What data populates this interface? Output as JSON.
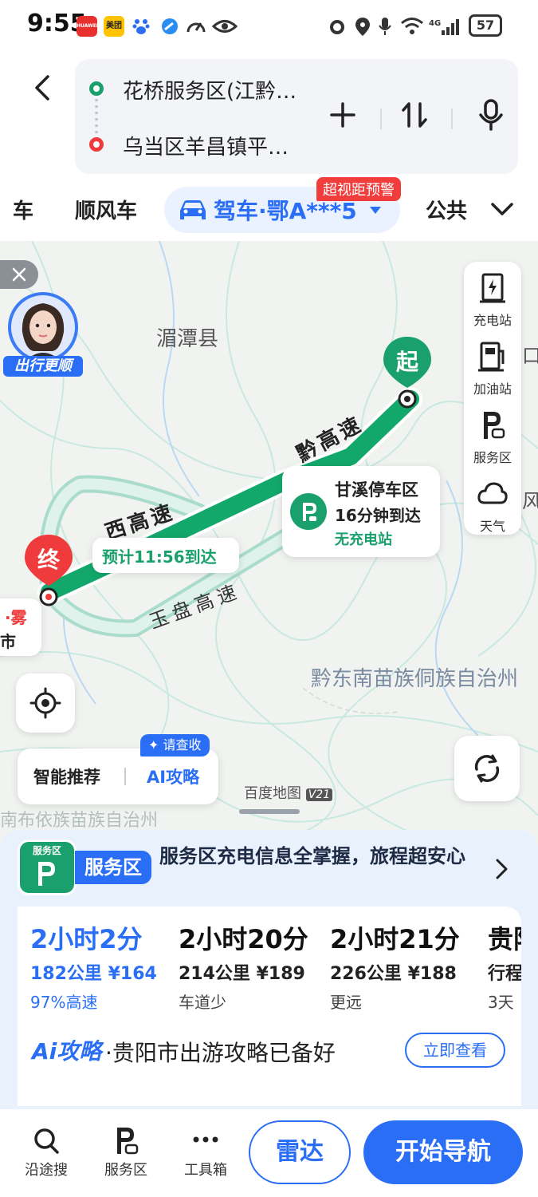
{
  "status_bar": {
    "time": "9:55",
    "app_icons": [
      {
        "name": "huawei-icon",
        "text": "HUAWEI",
        "color": "#e8312f"
      },
      {
        "name": "meituan-icon",
        "text": "美团",
        "color": "#ffc300"
      },
      {
        "name": "baidu-icon",
        "text": "du",
        "color": "#2a6ef5"
      },
      {
        "name": "browser-icon",
        "text": "",
        "color": "#2a6ef5"
      }
    ],
    "battery": "57"
  },
  "route": {
    "origin": "花桥服务区(江黔…",
    "destination": "乌当区羊昌镇平…",
    "add_label": "+",
    "swap_label": "⇅"
  },
  "modes": {
    "items": [
      "车",
      "顺风车"
    ],
    "active": "驾车·鄂A***5",
    "next": "公共",
    "badge": "超视距预警"
  },
  "map": {
    "place_labels": [
      "湄潭县",
      "黔东南苗族侗族自治州"
    ],
    "edge_labels": [
      "·雾",
      "市",
      "口",
      "风"
    ],
    "road_labels": [
      "黔高速",
      "西高速",
      "玉盘高速"
    ],
    "start_marker": "起",
    "end_marker": "终",
    "eta_label": "预计11:56到达",
    "service_area": {
      "name": "甘溪停车区",
      "eta": "16分钟到达",
      "note": "无充电站"
    },
    "avatar_label": "出行更顺",
    "watermark": "百度地图",
    "watermark_ver": "V21",
    "bottom_fade_text": "南布依族苗族自治州",
    "tools": [
      {
        "name": "charging-station",
        "label": "充电站"
      },
      {
        "name": "gas-station",
        "label": "加油站"
      },
      {
        "name": "service-area",
        "label": "服务区"
      },
      {
        "name": "weather",
        "label": "天气"
      }
    ],
    "recommend": {
      "left": "智能推荐",
      "right": "AI攻略",
      "tip": "请查收"
    }
  },
  "banner": {
    "badge_small": "服务区",
    "badge": "服务区",
    "text": "服务区充电信息全掌握，旅程超安心"
  },
  "routes": [
    {
      "time": "2小时2分",
      "distance": "182公里",
      "cost": "¥164",
      "tag": "97%高速",
      "active": true
    },
    {
      "time": "2小时20分",
      "distance": "214公里",
      "cost": "¥189",
      "tag": "车道少",
      "active": false
    },
    {
      "time": "2小时21分",
      "distance": "226公里",
      "cost": "¥188",
      "tag": "更远",
      "active": false
    },
    {
      "time": "贵阳",
      "distance": "行程",
      "cost": "",
      "tag": "3天",
      "active": false
    }
  ],
  "ai_guide": {
    "brand": "Ai攻略",
    "text": "·贵阳市出游攻略已备好",
    "button": "立即查看"
  },
  "bottom_nav": [
    {
      "name": "search-along",
      "label": "沿途搜"
    },
    {
      "name": "service-area",
      "label": "服务区"
    },
    {
      "name": "toolbox",
      "label": "工具箱"
    }
  ],
  "actions": {
    "radar": "雷达",
    "start": "开始导航"
  },
  "colors": {
    "accent": "#2a6ef5",
    "route_green": "#13a86b",
    "start_green": "#1aa06d",
    "end_red": "#ef3b3b"
  }
}
